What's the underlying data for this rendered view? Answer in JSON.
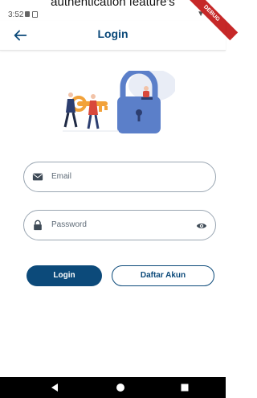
{
  "caption": "authentication feature's",
  "status_bar": {
    "time": "3:52"
  },
  "app_bar": {
    "title": "Login"
  },
  "form": {
    "email_placeholder": "Email",
    "password_placeholder": "Password"
  },
  "buttons": {
    "login_label": "Login",
    "register_label": "Daftar Akun"
  },
  "colors": {
    "primary": "#0c4a7a",
    "border": "#9aa6b2",
    "navbar": "#000000"
  },
  "icons": [
    "back-arrow-icon",
    "email-icon",
    "lock-icon",
    "eye-icon",
    "nav-back-icon",
    "nav-home-icon",
    "nav-recents-icon"
  ]
}
